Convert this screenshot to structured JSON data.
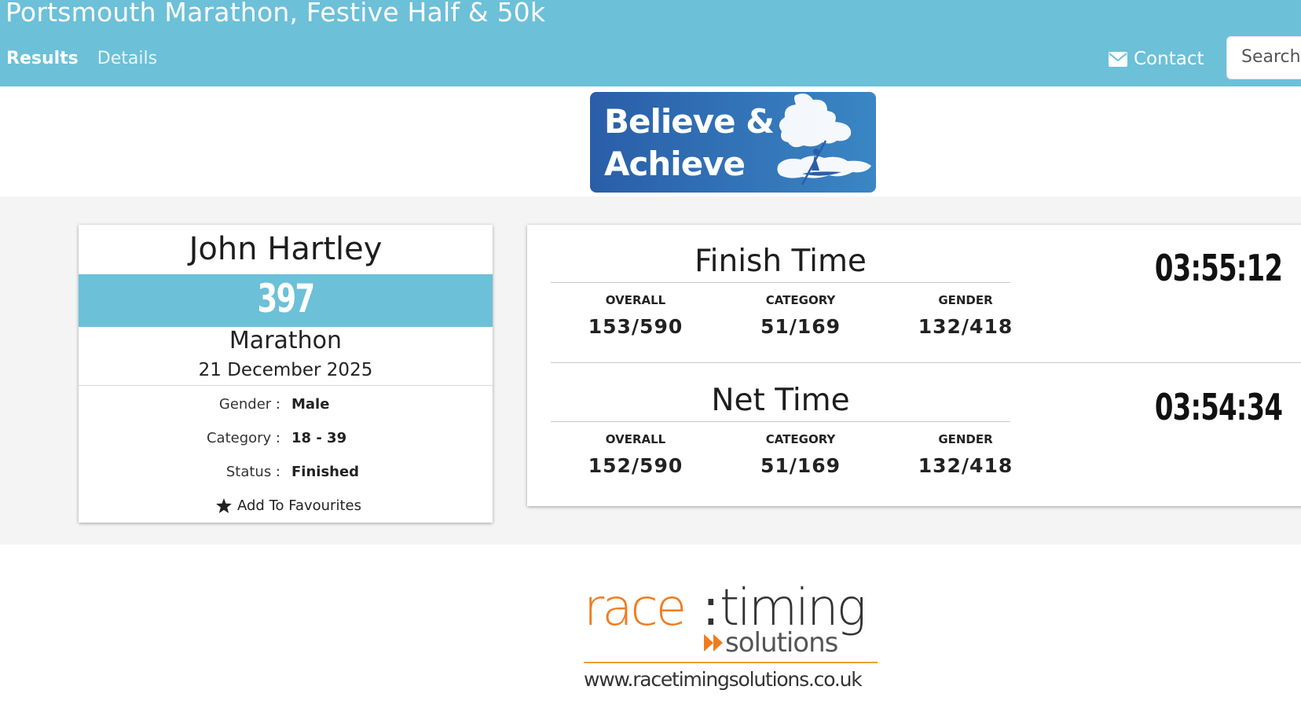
{
  "header": {
    "title": "Portsmouth Marathon, Festive Half & 50k",
    "nav": [
      {
        "label": "Results"
      },
      {
        "label": "Details"
      }
    ],
    "contact_label": "Contact",
    "search_placeholder": "Search"
  },
  "banner": {
    "line1": "Believe &",
    "line2": "Achieve"
  },
  "athlete": {
    "name": "John Hartley",
    "bib": "397",
    "race": "Marathon",
    "date": "21 December 2025",
    "details": [
      {
        "key": "Gender :",
        "value": "Male"
      },
      {
        "key": "Category :",
        "value": "18 - 39"
      },
      {
        "key": "Status :",
        "value": "Finished"
      }
    ],
    "favourite_label": "Add To Favourites"
  },
  "results": [
    {
      "title": "Finish Time",
      "time": "03:55:12",
      "columns": [
        {
          "label": "OVERALL",
          "value": "153/590"
        },
        {
          "label": "CATEGORY",
          "value": "51/169"
        },
        {
          "label": "GENDER",
          "value": "132/418"
        }
      ]
    },
    {
      "title": "Net Time",
      "time": "03:54:34",
      "columns": [
        {
          "label": "OVERALL",
          "value": "152/590"
        },
        {
          "label": "CATEGORY",
          "value": "51/169"
        },
        {
          "label": "GENDER",
          "value": "132/418"
        }
      ]
    }
  ],
  "footer": {
    "brand_race": "race",
    "brand_colon": ":",
    "brand_timing": "timing",
    "brand_solutions": "solutions",
    "url": "www.racetimingsolutions.co.uk"
  },
  "colors": {
    "header_bg": "#6cc0d8",
    "bib_bg": "#6cc0d8",
    "band_bg": "#f4f4f4",
    "brand_orange": "#f07c1e",
    "banner_blue": "#2f6fb4"
  },
  "icons": {
    "contact": "envelope-icon",
    "favourite": "star-icon"
  }
}
